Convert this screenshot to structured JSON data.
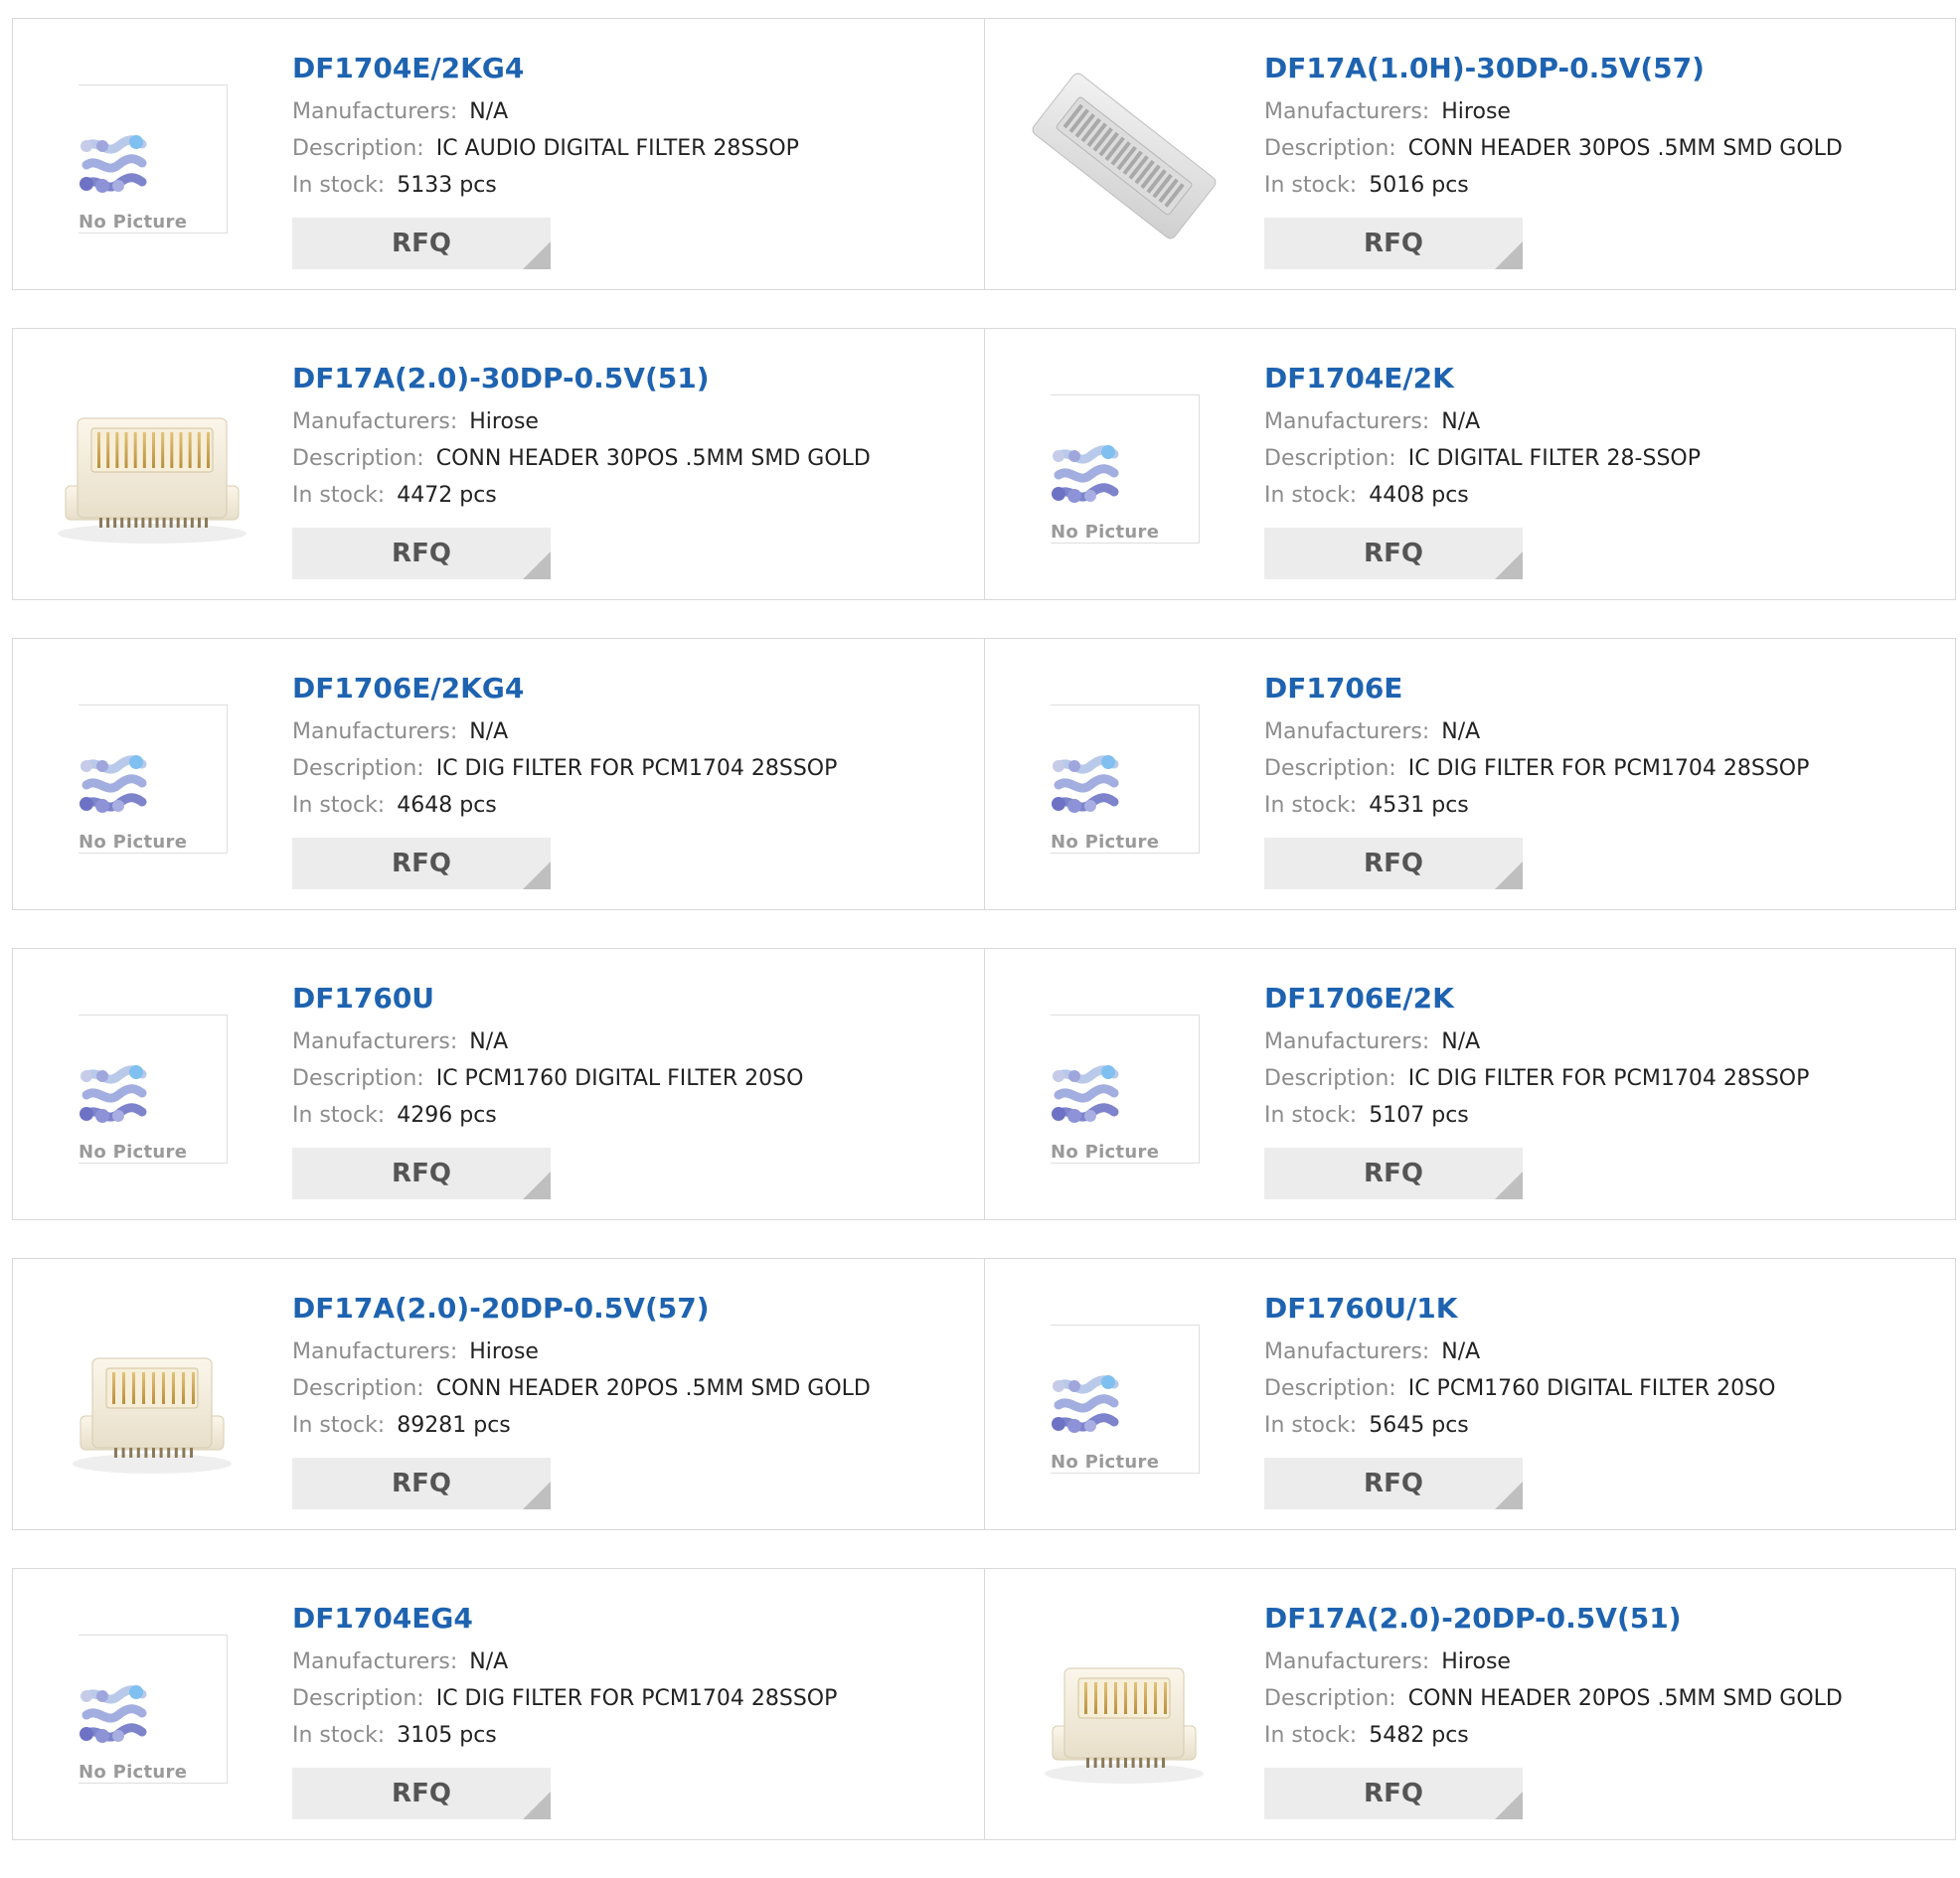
{
  "labels": {
    "manufacturers": "Manufacturers:",
    "description": "Description:",
    "in_stock": "In stock:",
    "pcs": "pcs",
    "rfq": "RFQ",
    "no_picture": "No Picture"
  },
  "colors": {
    "part_link": "#1e63b0",
    "label": "#8c8c8c",
    "value": "#222222",
    "rfq_bg": "#ececec",
    "card_border": "#d9d9d9"
  },
  "rows": [
    [
      {
        "part": "DF1704E/2KG4",
        "manufacturer": "N/A",
        "description": "IC AUDIO DIGITAL FILTER 28SSOP",
        "stock": "5133",
        "image": "no-picture"
      },
      {
        "part": "DF17A(1.0H)-30DP-0.5V(57)",
        "manufacturer": "Hirose",
        "description": "CONN HEADER 30POS .5MM SMD GOLD",
        "stock": "5016",
        "image": "connector-flat"
      }
    ],
    [
      {
        "part": "DF17A(2.0)-30DP-0.5V(51)",
        "manufacturer": "Hirose",
        "description": "CONN HEADER 30POS .5MM SMD GOLD",
        "stock": "4472",
        "image": "connector-tall"
      },
      {
        "part": "DF1704E/2K",
        "manufacturer": "N/A",
        "description": "IC DIGITAL FILTER 28-SSOP",
        "stock": "4408",
        "image": "no-picture"
      }
    ],
    [
      {
        "part": "DF1706E/2KG4",
        "manufacturer": "N/A",
        "description": "IC DIG FILTER FOR PCM1704 28SSOP",
        "stock": "4648",
        "image": "no-picture"
      },
      {
        "part": "DF1706E",
        "manufacturer": "N/A",
        "description": "IC DIG FILTER FOR PCM1704 28SSOP",
        "stock": "4531",
        "image": "no-picture"
      }
    ],
    [
      {
        "part": "DF1760U",
        "manufacturer": "N/A",
        "description": "IC PCM1760 DIGITAL FILTER 20SO",
        "stock": "4296",
        "image": "no-picture"
      },
      {
        "part": "DF1706E/2K",
        "manufacturer": "N/A",
        "description": "IC DIG FILTER FOR PCM1704 28SSOP",
        "stock": "5107",
        "image": "no-picture"
      }
    ],
    [
      {
        "part": "DF17A(2.0)-20DP-0.5V(57)",
        "manufacturer": "Hirose",
        "description": "CONN HEADER 20POS .5MM SMD GOLD",
        "stock": "89281",
        "image": "connector-small"
      },
      {
        "part": "DF1760U/1K",
        "manufacturer": "N/A",
        "description": "IC PCM1760 DIGITAL FILTER 20SO",
        "stock": "5645",
        "image": "no-picture"
      }
    ],
    [
      {
        "part": "DF1704EG4",
        "manufacturer": "N/A",
        "description": "IC DIG FILTER FOR PCM1704 28SSOP",
        "stock": "3105",
        "image": "no-picture"
      },
      {
        "part": "DF17A(2.0)-20DP-0.5V(51)",
        "manufacturer": "Hirose",
        "description": "CONN HEADER 20POS .5MM SMD GOLD",
        "stock": "5482",
        "image": "connector-small"
      }
    ]
  ]
}
